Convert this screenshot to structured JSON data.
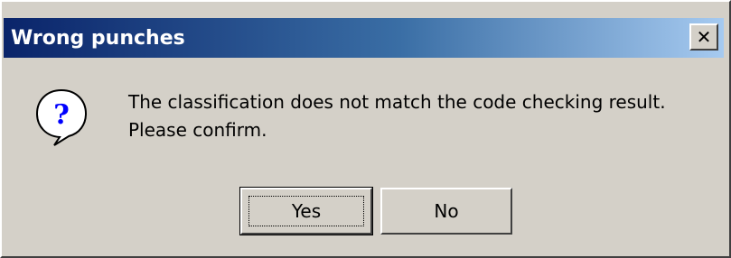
{
  "dialog": {
    "title": "Wrong punches",
    "close_label": "✕",
    "message_line1": "The classification does not match the code checking result.",
    "message_line2": "Please confirm.",
    "icon": "question-icon",
    "buttons": {
      "yes_label": "Yes",
      "no_label": "No"
    }
  },
  "colors": {
    "dialog_bg": "#d4d0c8",
    "title_gradient_start": "#0a246a",
    "title_gradient_end": "#a6caf0",
    "title_text": "#ffffff",
    "icon_question_mark": "#0000ff"
  }
}
